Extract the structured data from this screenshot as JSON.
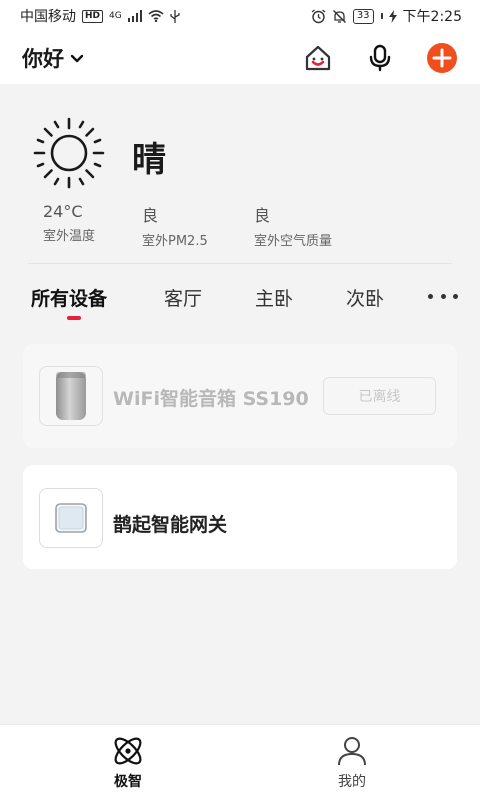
{
  "status_bar": {
    "carrier": "中国移动",
    "hd": "HD",
    "network": "4G",
    "battery": "33",
    "time": "下午2:25"
  },
  "header": {
    "greeting": "你好"
  },
  "weather": {
    "condition": "晴",
    "stats": [
      {
        "value": "24°C",
        "label": "室外温度"
      },
      {
        "value": "良",
        "label": "室外PM2.5"
      },
      {
        "value": "良",
        "label": "室外空气质量"
      }
    ]
  },
  "tabs": {
    "items": [
      "所有设备",
      "客厅",
      "主卧",
      "次卧"
    ],
    "active_index": 0,
    "accent_color": "#e5213b"
  },
  "devices": [
    {
      "name": "WiFi智能音箱 SS190",
      "status": "已离线",
      "icon": "smart-speaker-icon"
    },
    {
      "name": "鹊起智能网关",
      "icon": "gateway-icon"
    }
  ],
  "bottom_nav": {
    "items": [
      {
        "label": "极智",
        "icon": "atom-icon"
      },
      {
        "label": "我的",
        "icon": "person-icon"
      }
    ]
  },
  "colors": {
    "add_button": "#f04f1d",
    "home_icon_accent": "#e5213b"
  }
}
